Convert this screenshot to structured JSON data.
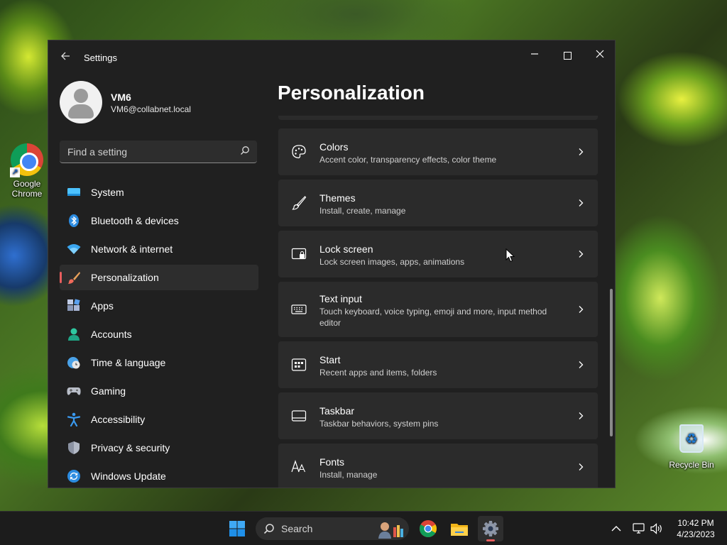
{
  "desktop": {
    "icons": [
      {
        "label": "Google Chrome",
        "icon": "chrome-icon"
      },
      {
        "label": "Recycle Bin",
        "icon": "recycle-bin-icon"
      }
    ]
  },
  "window": {
    "title": "Settings",
    "controls": {
      "minimize": "minimize-icon",
      "maximize": "maximize-icon",
      "close": "close-icon"
    }
  },
  "profile": {
    "name": "VM6",
    "email": "VM6@collabnet.local"
  },
  "search": {
    "placeholder": "Find a setting"
  },
  "nav": {
    "items": [
      {
        "label": "System",
        "icon": "system-icon"
      },
      {
        "label": "Bluetooth & devices",
        "icon": "bluetooth-icon"
      },
      {
        "label": "Network & internet",
        "icon": "wifi-icon"
      },
      {
        "label": "Personalization",
        "icon": "brush-icon",
        "active": true
      },
      {
        "label": "Apps",
        "icon": "apps-icon"
      },
      {
        "label": "Accounts",
        "icon": "accounts-icon"
      },
      {
        "label": "Time & language",
        "icon": "clock-globe-icon"
      },
      {
        "label": "Gaming",
        "icon": "gamepad-icon"
      },
      {
        "label": "Accessibility",
        "icon": "accessibility-icon"
      },
      {
        "label": "Privacy & security",
        "icon": "shield-icon"
      },
      {
        "label": "Windows Update",
        "icon": "update-icon"
      }
    ]
  },
  "page": {
    "title": "Personalization",
    "cards": [
      {
        "title": "Colors",
        "subtitle": "Accent color, transparency effects, color theme",
        "icon": "palette-icon"
      },
      {
        "title": "Themes",
        "subtitle": "Install, create, manage",
        "icon": "brush-icon"
      },
      {
        "title": "Lock screen",
        "subtitle": "Lock screen images, apps, animations",
        "icon": "lock-screen-icon"
      },
      {
        "title": "Text input",
        "subtitle": "Touch keyboard, voice typing, emoji and more, input method editor",
        "icon": "keyboard-icon"
      },
      {
        "title": "Start",
        "subtitle": "Recent apps and items, folders",
        "icon": "start-icon"
      },
      {
        "title": "Taskbar",
        "subtitle": "Taskbar behaviors, system pins",
        "icon": "taskbar-icon"
      },
      {
        "title": "Fonts",
        "subtitle": "Install, manage",
        "icon": "fonts-icon"
      }
    ]
  },
  "taskbar": {
    "search_label": "Search",
    "apps": [
      "windows-start-icon",
      "chrome-icon",
      "file-explorer-icon",
      "settings-icon"
    ],
    "time": "10:42 PM",
    "date": "4/23/2023"
  },
  "colors": {
    "accent": "#e85d5d",
    "window_bg": "#202020",
    "card_bg": "#2b2b2b",
    "taskbar_bg": "#1c1c1c"
  }
}
